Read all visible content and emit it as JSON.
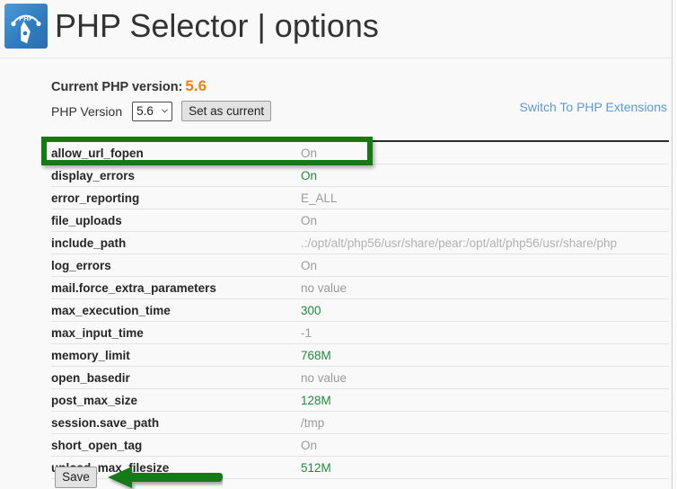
{
  "header": {
    "title": "PHP Selector | options",
    "icon": "php-gauge-icon"
  },
  "version": {
    "current_label": "Current PHP version:",
    "current_value": "5.6",
    "select_label": "PHP Version",
    "selected": "5.6",
    "options": [
      "5.6"
    ],
    "set_as_current_label": "Set as current",
    "switch_link_label": "Switch To PHP Extensions"
  },
  "colors": {
    "current_version": "#f2800a",
    "link": "#5b9bd5",
    "value_green": "#1f8a3d",
    "value_grey": "#9b9b9b",
    "annotation_green": "#147a14"
  },
  "options_table": {
    "rows": [
      {
        "name": "allow_url_fopen",
        "value": "On",
        "style": "grey"
      },
      {
        "name": "display_errors",
        "value": "On",
        "style": "green"
      },
      {
        "name": "error_reporting",
        "value": "E_ALL",
        "style": "grey"
      },
      {
        "name": "file_uploads",
        "value": "On",
        "style": "grey"
      },
      {
        "name": "include_path",
        "value": ".:/opt/alt/php56/usr/share/pear:/opt/alt/php56/usr/share/php",
        "style": "path"
      },
      {
        "name": "log_errors",
        "value": "On",
        "style": "grey"
      },
      {
        "name": "mail.force_extra_parameters",
        "value": "no value",
        "style": "grey"
      },
      {
        "name": "max_execution_time",
        "value": "300",
        "style": "green"
      },
      {
        "name": "max_input_time",
        "value": "-1",
        "style": "grey"
      },
      {
        "name": "memory_limit",
        "value": "768M",
        "style": "green"
      },
      {
        "name": "open_basedir",
        "value": "no value",
        "style": "grey"
      },
      {
        "name": "post_max_size",
        "value": "128M",
        "style": "green"
      },
      {
        "name": "session.save_path",
        "value": "/tmp",
        "style": "grey"
      },
      {
        "name": "short_open_tag",
        "value": "On",
        "style": "grey"
      },
      {
        "name": "upload_max_filesize",
        "value": "512M",
        "style": "green"
      }
    ]
  },
  "footer": {
    "save_label": "Save"
  },
  "annotations": {
    "highlight_target": "allow_url_fopen",
    "arrow_target": "Save"
  }
}
